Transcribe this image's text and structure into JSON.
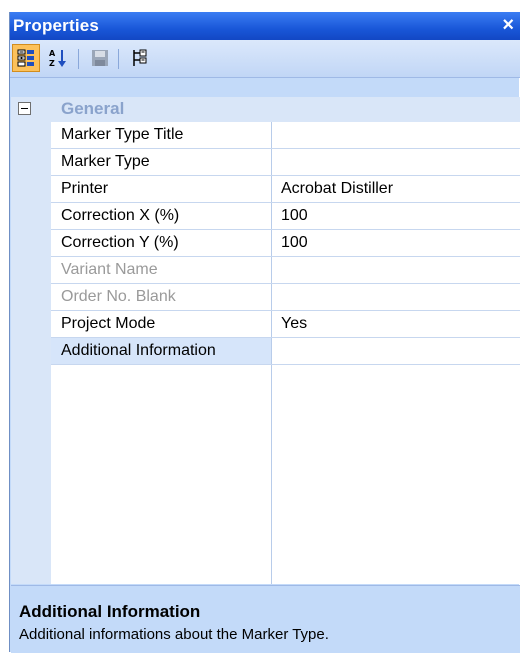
{
  "panel": {
    "title": "Properties",
    "close_glyph": "×"
  },
  "toolbar": {
    "buttons": [
      {
        "name": "categorized-icon",
        "active": true
      },
      {
        "name": "alphabetical-icon",
        "active": false
      },
      {
        "name": "save-icon",
        "active": false,
        "disabled": true
      },
      {
        "name": "property-pages-icon",
        "active": false
      }
    ]
  },
  "grid": {
    "category": {
      "label": "General",
      "expanded_glyph": "−"
    },
    "rows": [
      {
        "name": "Marker Type Title",
        "value": "",
        "disabled": false,
        "selected": false
      },
      {
        "name": "Marker Type",
        "value": "",
        "disabled": false,
        "selected": false
      },
      {
        "name": "Printer",
        "value": "Acrobat Distiller",
        "disabled": false,
        "selected": false
      },
      {
        "name": "Correction X (%)",
        "value": "100",
        "disabled": false,
        "selected": false
      },
      {
        "name": "Correction Y (%)",
        "value": "100",
        "disabled": false,
        "selected": false
      },
      {
        "name": "Variant Name",
        "value": "",
        "disabled": true,
        "selected": false
      },
      {
        "name": "Order No. Blank",
        "value": "",
        "disabled": true,
        "selected": false
      },
      {
        "name": "Project Mode",
        "value": "Yes",
        "disabled": false,
        "selected": false
      },
      {
        "name": "Additional Information",
        "value": "",
        "disabled": false,
        "selected": true
      }
    ]
  },
  "description": {
    "title": "Additional Information",
    "text": "Additional informations about the Marker Type."
  },
  "colors": {
    "titlebar": "#1957d8",
    "panel_bg": "#c3daf9",
    "active_button": "#fcc15a",
    "category_text": "#8aa3cc",
    "disabled_text": "#9a9a9a"
  }
}
